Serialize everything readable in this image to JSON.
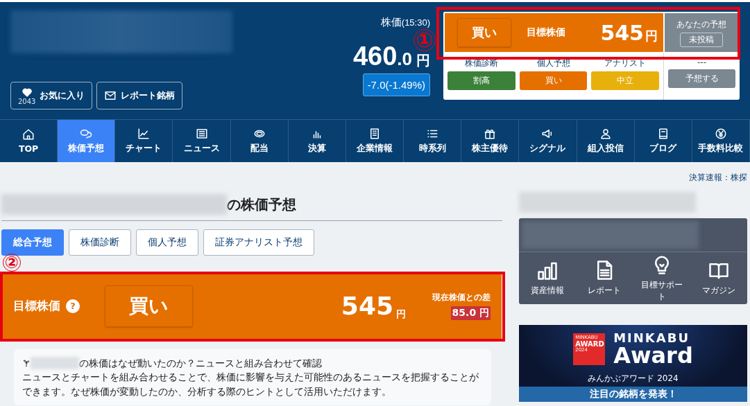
{
  "header": {
    "favorite_button": {
      "label": "お気に入り",
      "count": "2043"
    },
    "report_button": {
      "label": "レポート銘柄"
    },
    "price_label": "株価",
    "price_time": "(15:30)",
    "price_integer": "460",
    "price_decimal": ".0",
    "price_unit": "円",
    "change": "-7.0(-1.49%)"
  },
  "forecast_widget": {
    "rating": "買い",
    "target_label": "目標株価",
    "target_price": "545",
    "unit": "円",
    "your_forecast_label": "あなたの予想",
    "your_forecast_status": "未投稿",
    "categories": [
      {
        "label": "株価診断",
        "value": "割高",
        "color": "#3b8139"
      },
      {
        "label": "個人予想",
        "value": "買い",
        "color": "#e57000"
      },
      {
        "label": "アナリスト",
        "value": "中立",
        "color": "#e8b00c"
      }
    ],
    "your_action": {
      "label": "---",
      "button": "予想する"
    }
  },
  "nav": [
    {
      "label": "TOP",
      "selected": false
    },
    {
      "label": "株価予想",
      "selected": true
    },
    {
      "label": "チャート",
      "selected": false
    },
    {
      "label": "ニュース",
      "selected": false
    },
    {
      "label": "配当",
      "selected": false
    },
    {
      "label": "決算",
      "selected": false
    },
    {
      "label": "企業情報",
      "selected": false
    },
    {
      "label": "時系列",
      "selected": false
    },
    {
      "label": "株主優待",
      "selected": false
    },
    {
      "label": "シグナル",
      "selected": false
    },
    {
      "label": "組入投信",
      "selected": false
    },
    {
      "label": "ブログ",
      "selected": false
    },
    {
      "label": "手数料比較",
      "selected": false
    }
  ],
  "breaking_news_link": "決算速報：株探",
  "page_title_suffix": "の株価予想",
  "tabs": [
    {
      "label": "総合予想",
      "selected": true
    },
    {
      "label": "株価診断",
      "selected": false
    },
    {
      "label": "個人予想",
      "selected": false
    },
    {
      "label": "証券アナリスト予想",
      "selected": false
    }
  ],
  "target_banner": {
    "label": "目標株価",
    "help": "?",
    "rating": "買い",
    "price": "545",
    "unit": "円",
    "diff_label": "現在株価との差",
    "diff": "85.0",
    "diff_unit": "円"
  },
  "info": {
    "headline_suffix": "の株価はなぜ動いたのか？ニュースと組み合わせて確認",
    "body": "ニュースとチャートを組み合わせることで、株価に影響を与えた可能性のあるニュースを把握することができます。なぜ株価が変動したのか、分析する際のヒントとして活用いただけます。"
  },
  "side_menu": [
    {
      "label": "資産情報"
    },
    {
      "label": "レポート"
    },
    {
      "label": "目標サポート"
    },
    {
      "label": "マガジン"
    }
  ],
  "award": {
    "badge_brand": "MINKABU",
    "badge_title": "AWARD",
    "badge_year": "2024",
    "title_top": "MINKABU",
    "title_main": "Award",
    "subtitle": "みんかぶアワード 2024",
    "cta": "注目の銘柄を発表！"
  },
  "annotations": [
    "①",
    "②"
  ]
}
